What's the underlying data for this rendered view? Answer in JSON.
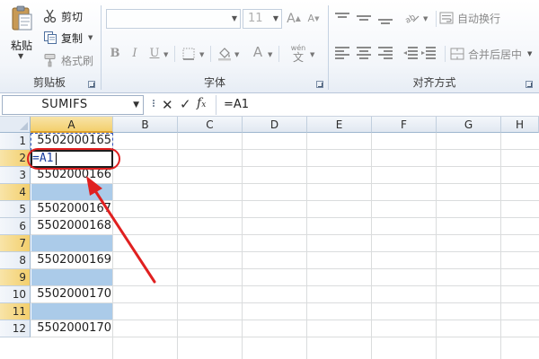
{
  "ribbon": {
    "clipboard": {
      "label": "剪贴板",
      "paste": "粘贴",
      "cut": "剪切",
      "copy": "复制",
      "format_painter": "格式刷"
    },
    "font": {
      "label": "字体",
      "font_name": "",
      "font_size": "11",
      "bold": "B",
      "italic": "I",
      "underline": "U",
      "font_color_glyph": "A"
    },
    "alignment": {
      "label": "对齐方式",
      "wrap_text": "自动换行",
      "merge_center": "合并后居中"
    }
  },
  "formula_bar": {
    "name_box": "SUMIFS",
    "cancel_glyph": "✕",
    "enter_glyph": "✓",
    "fx_glyph": "f",
    "fx_sub": "x",
    "formula": "=A1"
  },
  "sheet": {
    "columns": [
      "A",
      "B",
      "C",
      "D",
      "E",
      "F",
      "G",
      "H"
    ],
    "rows": [
      "1",
      "2",
      "3",
      "4",
      "5",
      "6",
      "7",
      "8",
      "9",
      "10",
      "11",
      "12"
    ],
    "column_a": [
      "5502000165",
      "",
      "5502000166",
      "",
      "5502000167",
      "5502000168",
      "",
      "5502000169",
      "",
      "5502000170",
      "",
      "5502000170"
    ],
    "editing_text": "=A1"
  },
  "colors": {
    "highlight_fill": "#abcbe9",
    "active_header": "#f3cf6d",
    "annotation": "#e02020"
  }
}
